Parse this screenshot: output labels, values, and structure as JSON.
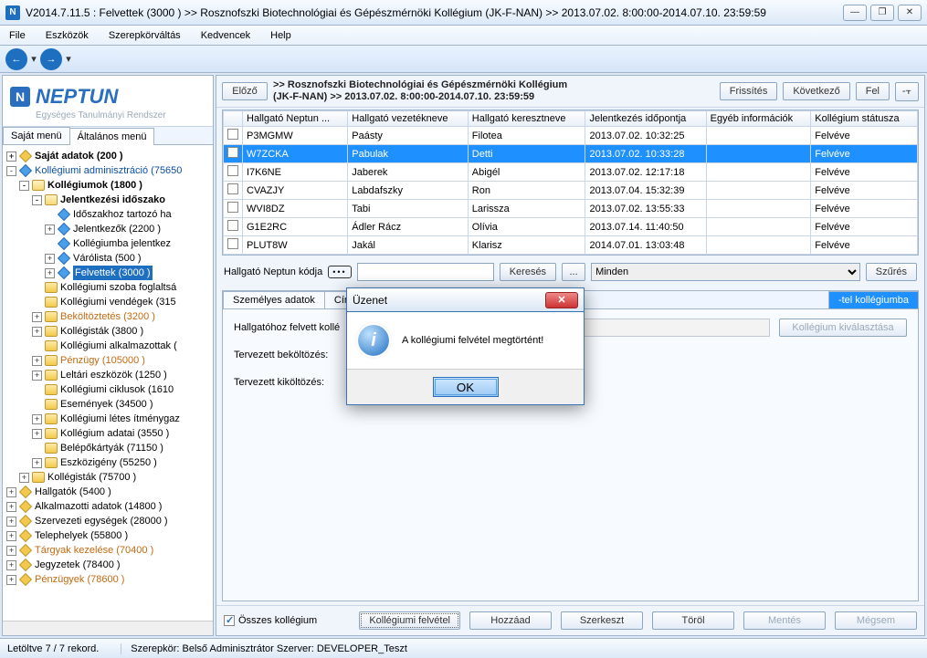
{
  "window": {
    "title": "V2014.7.11.5 : Felvettek (3000  )  >> Rosznofszki Biotechnológiai és Gépészmérnöki Kollégium (JK-F-NAN) >> 2013.07.02. 8:00:00-2014.07.10. 23:59:59",
    "min": "—",
    "max": "❐",
    "close": "✕"
  },
  "menu": [
    "File",
    "Eszközök",
    "Szerepkörváltás",
    "Kedvencek",
    "Help"
  ],
  "logo": {
    "brand": "NEPTUN",
    "sub": "Egységes Tanulmányi Rendszer"
  },
  "left_tabs": {
    "own": "Saját menü",
    "general": "Általános menü"
  },
  "tree": [
    {
      "indent": 0,
      "exp": "+",
      "style": "bold",
      "icon": "diamond-gold",
      "label": "Saját adatok (200  )"
    },
    {
      "indent": 0,
      "exp": "-",
      "style": "blue",
      "icon": "diamond-blue",
      "label": "Kollégiumi adminisztráció (75650"
    },
    {
      "indent": 1,
      "exp": "-",
      "style": "bold",
      "icon": "folder-open",
      "label": "Kollégiumok (1800  )"
    },
    {
      "indent": 2,
      "exp": "-",
      "style": "bold",
      "icon": "folder-open",
      "label": "Jelentkezési időszako"
    },
    {
      "indent": 3,
      "exp": "",
      "style": "",
      "icon": "diamond-blue",
      "label": "Időszakhoz tartozó ha"
    },
    {
      "indent": 3,
      "exp": "+",
      "style": "",
      "icon": "diamond-blue",
      "label": "Jelentkezők (2200  )"
    },
    {
      "indent": 3,
      "exp": "",
      "style": "",
      "icon": "diamond-blue",
      "label": "Kollégiumba jelentkez"
    },
    {
      "indent": 3,
      "exp": "+",
      "style": "",
      "icon": "diamond-blue",
      "label": "Várólista (500  )"
    },
    {
      "indent": 3,
      "exp": "+",
      "style": "selected",
      "icon": "diamond-blue",
      "label": "Felvettek (3000  )"
    },
    {
      "indent": 2,
      "exp": "",
      "style": "",
      "icon": "folder",
      "label": "Kollégiumi szoba foglaltsá"
    },
    {
      "indent": 2,
      "exp": "",
      "style": "",
      "icon": "folder",
      "label": "Kollégiumi vendégek (315"
    },
    {
      "indent": 2,
      "exp": "+",
      "style": "orange",
      "icon": "folder",
      "label": "Beköltöztetés (3200  )"
    },
    {
      "indent": 2,
      "exp": "+",
      "style": "",
      "icon": "folder",
      "label": "Kollégisták (3800  )"
    },
    {
      "indent": 2,
      "exp": "",
      "style": "",
      "icon": "folder",
      "label": "Kollégiumi alkalmazottak ("
    },
    {
      "indent": 2,
      "exp": "+",
      "style": "orange",
      "icon": "folder",
      "label": "Pénzügy (105000  )"
    },
    {
      "indent": 2,
      "exp": "+",
      "style": "",
      "icon": "folder",
      "label": "Leltári eszközök (1250  )"
    },
    {
      "indent": 2,
      "exp": "",
      "style": "",
      "icon": "folder",
      "label": "Kollégiumi ciklusok (1610"
    },
    {
      "indent": 2,
      "exp": "",
      "style": "",
      "icon": "folder",
      "label": "Események (34500  )"
    },
    {
      "indent": 2,
      "exp": "+",
      "style": "",
      "icon": "folder",
      "label": "Kollégiumi létes ítménygaz"
    },
    {
      "indent": 2,
      "exp": "+",
      "style": "",
      "icon": "folder",
      "label": "Kollégium adatai (3550  )"
    },
    {
      "indent": 2,
      "exp": "",
      "style": "",
      "icon": "folder",
      "label": "Belépőkártyák (71150  )"
    },
    {
      "indent": 2,
      "exp": "+",
      "style": "",
      "icon": "folder",
      "label": "Eszközigény (55250  )"
    },
    {
      "indent": 1,
      "exp": "+",
      "style": "",
      "icon": "folder",
      "label": "Kollégisták (75700  )"
    },
    {
      "indent": 0,
      "exp": "+",
      "style": "",
      "icon": "diamond-gold",
      "label": "Hallgatók (5400  )"
    },
    {
      "indent": 0,
      "exp": "+",
      "style": "",
      "icon": "diamond-gold",
      "label": "Alkalmazotti adatok (14800  )"
    },
    {
      "indent": 0,
      "exp": "+",
      "style": "",
      "icon": "diamond-gold",
      "label": "Szervezeti egységek (28000  )"
    },
    {
      "indent": 0,
      "exp": "+",
      "style": "",
      "icon": "diamond-gold",
      "label": "Telephelyek (55800  )"
    },
    {
      "indent": 0,
      "exp": "+",
      "style": "orange",
      "icon": "diamond-gold",
      "label": "Tárgyak kezelése (70400  )"
    },
    {
      "indent": 0,
      "exp": "+",
      "style": "",
      "icon": "diamond-gold",
      "label": "Jegyzetek (78400  )"
    },
    {
      "indent": 0,
      "exp": "+",
      "style": "orange",
      "icon": "diamond-gold",
      "label": "Pénzügyek (78600  )"
    }
  ],
  "header_btns": {
    "prev": "Előző",
    "refresh": "Frissítés",
    "next": "Következő",
    "up": "Fel",
    "pin": "-⫟"
  },
  "crumb_line1": ">>  Rosznofszki Biotechnológiai és Gépészmérnöki Kollégium",
  "crumb_line2": "(JK-F-NAN) >> 2013.07.02. 8:00:00-2014.07.10. 23:59:59",
  "grid": {
    "columns": [
      "",
      "Hallgató Neptun ...",
      "Hallgató vezetékneve",
      "Hallgató keresztneve",
      "Jelentkezés időpontja",
      "Egyéb információk",
      "Kollégium státusza"
    ],
    "rows": [
      {
        "code": "P3MGMW",
        "last": "Paásty",
        "first": "Filotea",
        "date": "2013.07.02. 10:32:25",
        "info": "",
        "status": "Felvéve",
        "sel": false
      },
      {
        "code": "W7ZCKA",
        "last": "Pabulak",
        "first": "Detti",
        "date": "2013.07.02. 10:33:28",
        "info": "",
        "status": "Felvéve",
        "sel": true
      },
      {
        "code": "I7K6NE",
        "last": "Jaberek",
        "first": "Abigél",
        "date": "2013.07.02. 12:17:18",
        "info": "",
        "status": "Felvéve",
        "sel": false
      },
      {
        "code": "CVAZJY",
        "last": "Labdafszky",
        "first": "Ron",
        "date": "2013.07.04. 15:32:39",
        "info": "",
        "status": "Felvéve",
        "sel": false
      },
      {
        "code": "WVI8DZ",
        "last": "Tabi",
        "first": "Larissza",
        "date": "2013.07.02. 13:55:33",
        "info": "",
        "status": "Felvéve",
        "sel": false
      },
      {
        "code": "G1E2RC",
        "last": "Ádler Rácz",
        "first": "Olívia",
        "date": "2013.07.14. 11:40:50",
        "info": "",
        "status": "Felvéve",
        "sel": false
      },
      {
        "code": "PLUT8W",
        "last": "Jakál",
        "first": "Klarisz",
        "date": "2014.07.01. 13:03:48",
        "info": "",
        "status": "Felvéve",
        "sel": false
      }
    ]
  },
  "search": {
    "label": "Hallgató Neptun kódja",
    "btn": "Keresés",
    "more": "...",
    "filter_sel": "Minden",
    "filter_btn": "Szűrés"
  },
  "subtabs": {
    "t1": "Személyes adatok",
    "t2": "Cím",
    "t4": "-tel kollégiumba"
  },
  "subform": {
    "f1_label": "Hallgatóhoz felvett kollé",
    "pick_btn": "Kollégium kiválasztása",
    "f2_label": "Tervezett beköltözés:",
    "f3_label": "Tervezett kiköltözés:"
  },
  "actions": {
    "all_chk": "Összes kollégium",
    "b1": "Kollégiumi felvétel",
    "b2": "Hozzáad",
    "b3": "Szerkeszt",
    "b4": "Töröl",
    "b5": "Mentés",
    "b6": "Mégsem"
  },
  "status": {
    "records": "Letöltve 7 / 7 rekord.",
    "role": "Szerepkör: Belső Adminisztrátor   Szerver: DEVELOPER_Teszt"
  },
  "dialog": {
    "title": "Üzenet",
    "msg": "A kollégiumi felvétel megtörtént!",
    "ok": "OK",
    "x": "✕"
  }
}
